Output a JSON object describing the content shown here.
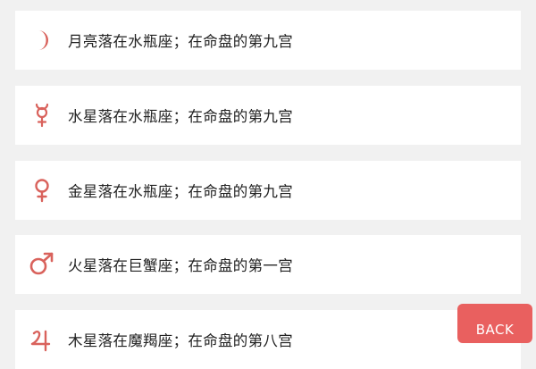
{
  "colors": {
    "accent": "#e9605f",
    "icon": "#d9625c",
    "background": "#f1f1f1",
    "card": "#ffffff"
  },
  "items": [
    {
      "icon": "moon-icon",
      "label": "月亮落在水瓶座；在命盘的第九宫"
    },
    {
      "icon": "mercury-icon",
      "label": "水星落在水瓶座；在命盘的第九宫"
    },
    {
      "icon": "venus-icon",
      "label": "金星落在水瓶座；在命盘的第九宫"
    },
    {
      "icon": "mars-icon",
      "label": "火星落在巨蟹座；在命盘的第一宫"
    },
    {
      "icon": "jupiter-icon",
      "label": "木星落在魔羯座；在命盘的第八宫"
    }
  ],
  "back_button": {
    "label": "BACK"
  }
}
